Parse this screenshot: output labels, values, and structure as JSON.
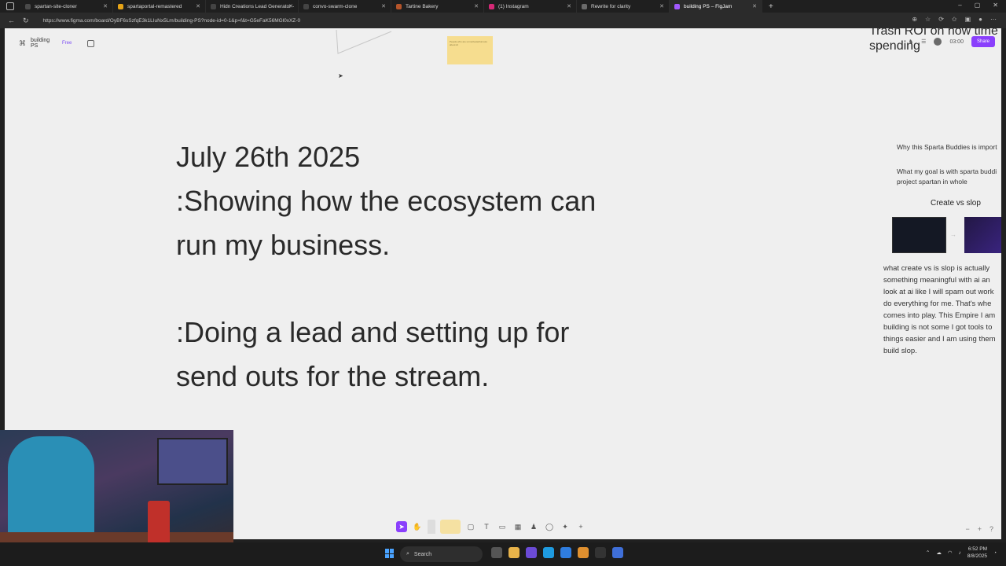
{
  "browser": {
    "tabs": [
      {
        "label": "spartan-site-cloner",
        "color": "#4a4a4a"
      },
      {
        "label": "spartaportal-remastered",
        "color": "#e6a417"
      },
      {
        "label": "Hidn Creations Lead Generator -",
        "color": "#444"
      },
      {
        "label": "convo-swarm-clone",
        "color": "#444"
      },
      {
        "label": "Tartine Bakery",
        "color": "#b5542a"
      },
      {
        "label": "(1) Instagram",
        "color": "#d62976"
      },
      {
        "label": "Rewrite for clarity",
        "color": "#6a6a6a"
      },
      {
        "label": "building PS – FigJam",
        "color": "#a259ff",
        "active": true
      }
    ],
    "url": "https://www.figma.com/board/OyBF6sSzfqE3k1LIuNx5Lm/building-PS?node-id=0-1&p=f&t=G5eFaK56MGl0xXZ-0"
  },
  "figjam": {
    "file_name": "building PS",
    "plan": "Free",
    "timer": "03:00",
    "share_label": "Share",
    "sticky_text": "People who are unmotivated/unsure about AI"
  },
  "board": {
    "main_lines": [
      "July 26th 2025",
      ":Showing how the ecosystem can",
      "run my business.",
      ":Doing a lead and setting up for",
      "send outs for the stream."
    ],
    "right_title": "Trash ROI on how time\nspending",
    "right_note1": "Why this Sparta Buddies is import",
    "right_note2_a": "What my goal is with sparta buddi",
    "right_note2_b": "project spartan in whole",
    "create_vs_slop": "Create vs slop",
    "paragraph": "what create vs is slop is actually something meaningful with ai an look at ai like I will spam out work do everything for me. That's whe comes into play. This Empire I am building is not some I got tools to things easier and I am using them build slop."
  },
  "taskbar": {
    "search": "Search",
    "time": "6:52 PM",
    "date": "8/8/2025"
  }
}
